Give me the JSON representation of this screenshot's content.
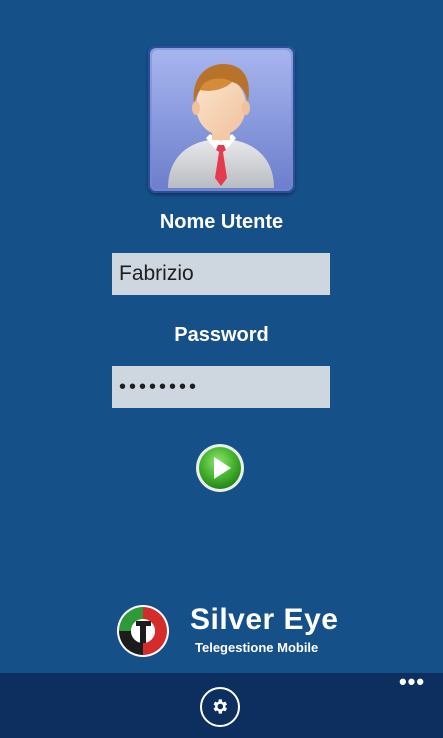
{
  "login": {
    "username_label": "Nome Utente",
    "username_value": "Fabrizio",
    "password_label": "Password",
    "password_value": "••••••••"
  },
  "brand": {
    "name": "Silver Eye",
    "subtitle": "Telegestione Mobile"
  },
  "appbar": {
    "more_label": "•••"
  },
  "icons": {
    "avatar": "user-avatar-icon",
    "submit": "play-arrow-icon",
    "settings": "gear-icon",
    "more": "ellipsis-icon",
    "logo": "brand-logo-icon"
  },
  "colors": {
    "background": "#155089",
    "appbar": "#0c2f5f",
    "field": "#ced6e0",
    "go_green": "#3fae2a"
  }
}
